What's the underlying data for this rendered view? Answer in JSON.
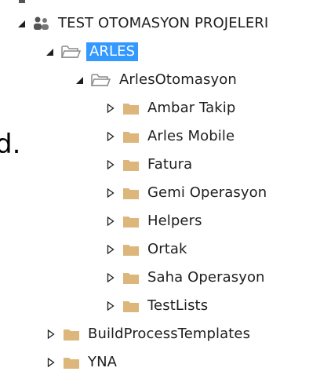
{
  "clipped_left_text": "d.",
  "tree": {
    "root": {
      "label": "TEST OTOMASYON PROJELERI",
      "expanded": true,
      "icon": "team-project-icon"
    },
    "arles": {
      "label": "ARLES",
      "expanded": true,
      "selected": true,
      "icon": "folder-open-icon"
    },
    "arles_otomasyon": {
      "label": "ArlesOtomasyon",
      "expanded": true,
      "icon": "folder-open-icon"
    },
    "children": [
      {
        "label": "Ambar Takip",
        "icon": "folder-icon"
      },
      {
        "label": "Arles Mobile",
        "icon": "folder-icon"
      },
      {
        "label": "Fatura",
        "icon": "folder-icon"
      },
      {
        "label": "Gemi Operasyon",
        "icon": "folder-icon"
      },
      {
        "label": "Helpers",
        "icon": "folder-icon"
      },
      {
        "label": "Ortak",
        "icon": "folder-icon"
      },
      {
        "label": "Saha Operasyon",
        "icon": "folder-icon"
      },
      {
        "label": "TestLists",
        "icon": "folder-icon"
      }
    ],
    "siblings": [
      {
        "label": "BuildProcessTemplates",
        "icon": "folder-icon"
      },
      {
        "label": "YNA",
        "icon": "folder-icon"
      }
    ]
  },
  "colors": {
    "selection": "#3399ff",
    "folder": "#dcb67a",
    "text": "#1e1e1e"
  }
}
